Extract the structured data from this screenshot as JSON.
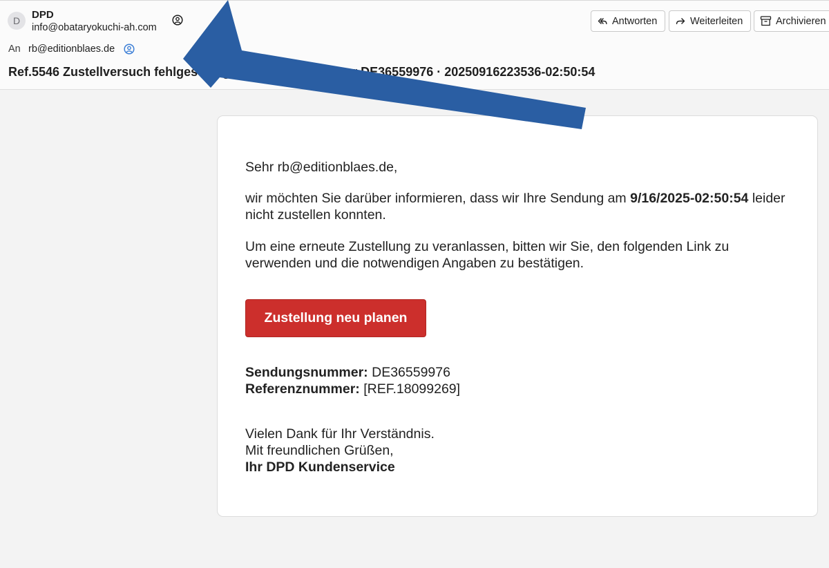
{
  "header": {
    "avatar_letter": "D",
    "sender_name": "DPD",
    "sender_email": "info@obataryokuchi-ah.com",
    "to_label": "An",
    "to_value": "rb@editionblaes.de",
    "subject": "Ref.5546 Zustellversuch fehlgeschlagen Sendungsnummer DE36559976 · 20250916223536-02:50:54",
    "icons": {
      "sender": "contact-icon",
      "recipient": "contact-icon"
    }
  },
  "toolbar": {
    "reply_label": "Antworten",
    "forward_label": "Weiterleiten",
    "archive_label": "Archivieren"
  },
  "email": {
    "greeting": "Sehr rb@editionblaes.de,",
    "p1_text": "wir möchten Sie darüber informieren, dass wir Ihre Sendung am ",
    "p1_date": "9/16/2025-02:50:54",
    "p1_text_end": " leider nicht zustellen konnten.",
    "p2_text": "Um eine erneute Zustellung zu veranlassen, bitten wir Sie, den folgenden Link zu verwenden und die notwendigen Angaben zu bestätigen.",
    "cta_label": "Zustellung neu planen",
    "tracking_label": "Sendungsnummer:",
    "tracking_value": " DE36559976",
    "reference_label": "Referenznummer:",
    "reference_value": " [REF.18099269]",
    "closing_thanks": "Vielen Dank für Ihr Verständnis.",
    "closing_regards": "Mit freundlichen Grüßen,",
    "closing_signature": "Ihr DPD Kundenservice"
  },
  "colors": {
    "cta_background": "#cc2f2c",
    "annotation_arrow": "#2a5ea3",
    "page_background": "#f3f3f3"
  }
}
